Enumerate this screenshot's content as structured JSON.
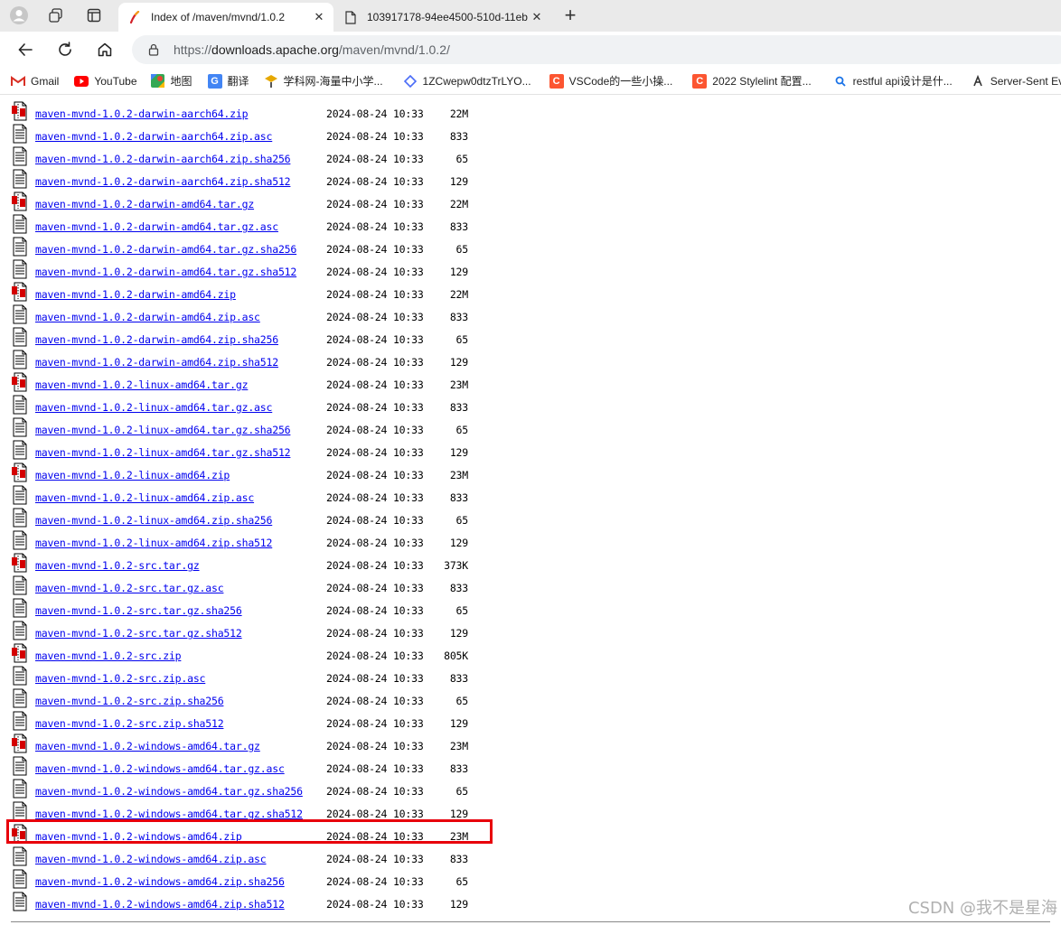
{
  "browser": {
    "tabs": [
      {
        "title": "Index of /maven/mvnd/1.0.2",
        "active": true,
        "icon": "apache-feather-icon"
      },
      {
        "title": "103917178-94ee4500-510d-11eb",
        "active": false,
        "icon": "page-icon"
      }
    ],
    "address": {
      "prefix": "https://",
      "host": "downloads.apache.org",
      "path": "/maven/mvnd/1.0.2/"
    },
    "bookmarks": [
      {
        "label": "Gmail",
        "icon": "gmail-icon",
        "color": "#d93025"
      },
      {
        "label": "YouTube",
        "icon": "youtube-icon",
        "color": "#ff0000"
      },
      {
        "label": "地图",
        "icon": "maps-icon",
        "color": "#34a853"
      },
      {
        "label": "翻译",
        "icon": "translate-icon",
        "color": "#4285f4"
      },
      {
        "label": "学科网-海量中小学...",
        "icon": "xueke-icon",
        "color": "#e6a800"
      },
      {
        "label": "1ZCwepw0dtzTrLYO...",
        "icon": "diamond-icon",
        "color": "#4a6cf7"
      },
      {
        "label": "VSCode的一些小操...",
        "icon": "csdn-icon",
        "color": "#fc5531"
      },
      {
        "label": "2022 Stylelint 配置...",
        "icon": "csdn-icon",
        "color": "#fc5531"
      },
      {
        "label": "restful api设计是什...",
        "icon": "search-icon",
        "color": "#1a73e8"
      },
      {
        "label": "Server-Sent Events",
        "icon": "script-icon",
        "color": "#333333"
      }
    ]
  },
  "listing": {
    "rows": [
      {
        "name": "maven-mvnd-1.0.2-darwin-aarch64.zip",
        "date": "2024-08-24 10:33",
        "size": "22M",
        "kind": "archive"
      },
      {
        "name": "maven-mvnd-1.0.2-darwin-aarch64.zip.asc",
        "date": "2024-08-24 10:33",
        "size": "833",
        "kind": "text"
      },
      {
        "name": "maven-mvnd-1.0.2-darwin-aarch64.zip.sha256",
        "date": "2024-08-24 10:33",
        "size": "65",
        "kind": "text"
      },
      {
        "name": "maven-mvnd-1.0.2-darwin-aarch64.zip.sha512",
        "date": "2024-08-24 10:33",
        "size": "129",
        "kind": "text"
      },
      {
        "name": "maven-mvnd-1.0.2-darwin-amd64.tar.gz",
        "date": "2024-08-24 10:33",
        "size": "22M",
        "kind": "archive"
      },
      {
        "name": "maven-mvnd-1.0.2-darwin-amd64.tar.gz.asc",
        "date": "2024-08-24 10:33",
        "size": "833",
        "kind": "text"
      },
      {
        "name": "maven-mvnd-1.0.2-darwin-amd64.tar.gz.sha256",
        "date": "2024-08-24 10:33",
        "size": "65",
        "kind": "text"
      },
      {
        "name": "maven-mvnd-1.0.2-darwin-amd64.tar.gz.sha512",
        "date": "2024-08-24 10:33",
        "size": "129",
        "kind": "text"
      },
      {
        "name": "maven-mvnd-1.0.2-darwin-amd64.zip",
        "date": "2024-08-24 10:33",
        "size": "22M",
        "kind": "archive"
      },
      {
        "name": "maven-mvnd-1.0.2-darwin-amd64.zip.asc",
        "date": "2024-08-24 10:33",
        "size": "833",
        "kind": "text"
      },
      {
        "name": "maven-mvnd-1.0.2-darwin-amd64.zip.sha256",
        "date": "2024-08-24 10:33",
        "size": "65",
        "kind": "text"
      },
      {
        "name": "maven-mvnd-1.0.2-darwin-amd64.zip.sha512",
        "date": "2024-08-24 10:33",
        "size": "129",
        "kind": "text"
      },
      {
        "name": "maven-mvnd-1.0.2-linux-amd64.tar.gz",
        "date": "2024-08-24 10:33",
        "size": "23M",
        "kind": "archive"
      },
      {
        "name": "maven-mvnd-1.0.2-linux-amd64.tar.gz.asc",
        "date": "2024-08-24 10:33",
        "size": "833",
        "kind": "text"
      },
      {
        "name": "maven-mvnd-1.0.2-linux-amd64.tar.gz.sha256",
        "date": "2024-08-24 10:33",
        "size": "65",
        "kind": "text"
      },
      {
        "name": "maven-mvnd-1.0.2-linux-amd64.tar.gz.sha512",
        "date": "2024-08-24 10:33",
        "size": "129",
        "kind": "text"
      },
      {
        "name": "maven-mvnd-1.0.2-linux-amd64.zip",
        "date": "2024-08-24 10:33",
        "size": "23M",
        "kind": "archive"
      },
      {
        "name": "maven-mvnd-1.0.2-linux-amd64.zip.asc",
        "date": "2024-08-24 10:33",
        "size": "833",
        "kind": "text"
      },
      {
        "name": "maven-mvnd-1.0.2-linux-amd64.zip.sha256",
        "date": "2024-08-24 10:33",
        "size": "65",
        "kind": "text"
      },
      {
        "name": "maven-mvnd-1.0.2-linux-amd64.zip.sha512",
        "date": "2024-08-24 10:33",
        "size": "129",
        "kind": "text"
      },
      {
        "name": "maven-mvnd-1.0.2-src.tar.gz",
        "date": "2024-08-24 10:33",
        "size": "373K",
        "kind": "archive"
      },
      {
        "name": "maven-mvnd-1.0.2-src.tar.gz.asc",
        "date": "2024-08-24 10:33",
        "size": "833",
        "kind": "text"
      },
      {
        "name": "maven-mvnd-1.0.2-src.tar.gz.sha256",
        "date": "2024-08-24 10:33",
        "size": "65",
        "kind": "text"
      },
      {
        "name": "maven-mvnd-1.0.2-src.tar.gz.sha512",
        "date": "2024-08-24 10:33",
        "size": "129",
        "kind": "text"
      },
      {
        "name": "maven-mvnd-1.0.2-src.zip",
        "date": "2024-08-24 10:33",
        "size": "805K",
        "kind": "archive"
      },
      {
        "name": "maven-mvnd-1.0.2-src.zip.asc",
        "date": "2024-08-24 10:33",
        "size": "833",
        "kind": "text"
      },
      {
        "name": "maven-mvnd-1.0.2-src.zip.sha256",
        "date": "2024-08-24 10:33",
        "size": "65",
        "kind": "text"
      },
      {
        "name": "maven-mvnd-1.0.2-src.zip.sha512",
        "date": "2024-08-24 10:33",
        "size": "129",
        "kind": "text"
      },
      {
        "name": "maven-mvnd-1.0.2-windows-amd64.tar.gz",
        "date": "2024-08-24 10:33",
        "size": "23M",
        "kind": "archive"
      },
      {
        "name": "maven-mvnd-1.0.2-windows-amd64.tar.gz.asc",
        "date": "2024-08-24 10:33",
        "size": "833",
        "kind": "text"
      },
      {
        "name": "maven-mvnd-1.0.2-windows-amd64.tar.gz.sha256",
        "date": "2024-08-24 10:33",
        "size": "65",
        "kind": "text"
      },
      {
        "name": "maven-mvnd-1.0.2-windows-amd64.tar.gz.sha512",
        "date": "2024-08-24 10:33",
        "size": "129",
        "kind": "text"
      },
      {
        "name": "maven-mvnd-1.0.2-windows-amd64.zip",
        "date": "2024-08-24 10:33",
        "size": "23M",
        "kind": "archive",
        "highlighted": true
      },
      {
        "name": "maven-mvnd-1.0.2-windows-amd64.zip.asc",
        "date": "2024-08-24 10:33",
        "size": "833",
        "kind": "text"
      },
      {
        "name": "maven-mvnd-1.0.2-windows-amd64.zip.sha256",
        "date": "2024-08-24 10:33",
        "size": "65",
        "kind": "text"
      },
      {
        "name": "maven-mvnd-1.0.2-windows-amd64.zip.sha512",
        "date": "2024-08-24 10:33",
        "size": "129",
        "kind": "text"
      }
    ]
  },
  "highlight_color": "#e8000b",
  "link_color": "#0000ee",
  "watermark": "CSDN @我不是星海"
}
